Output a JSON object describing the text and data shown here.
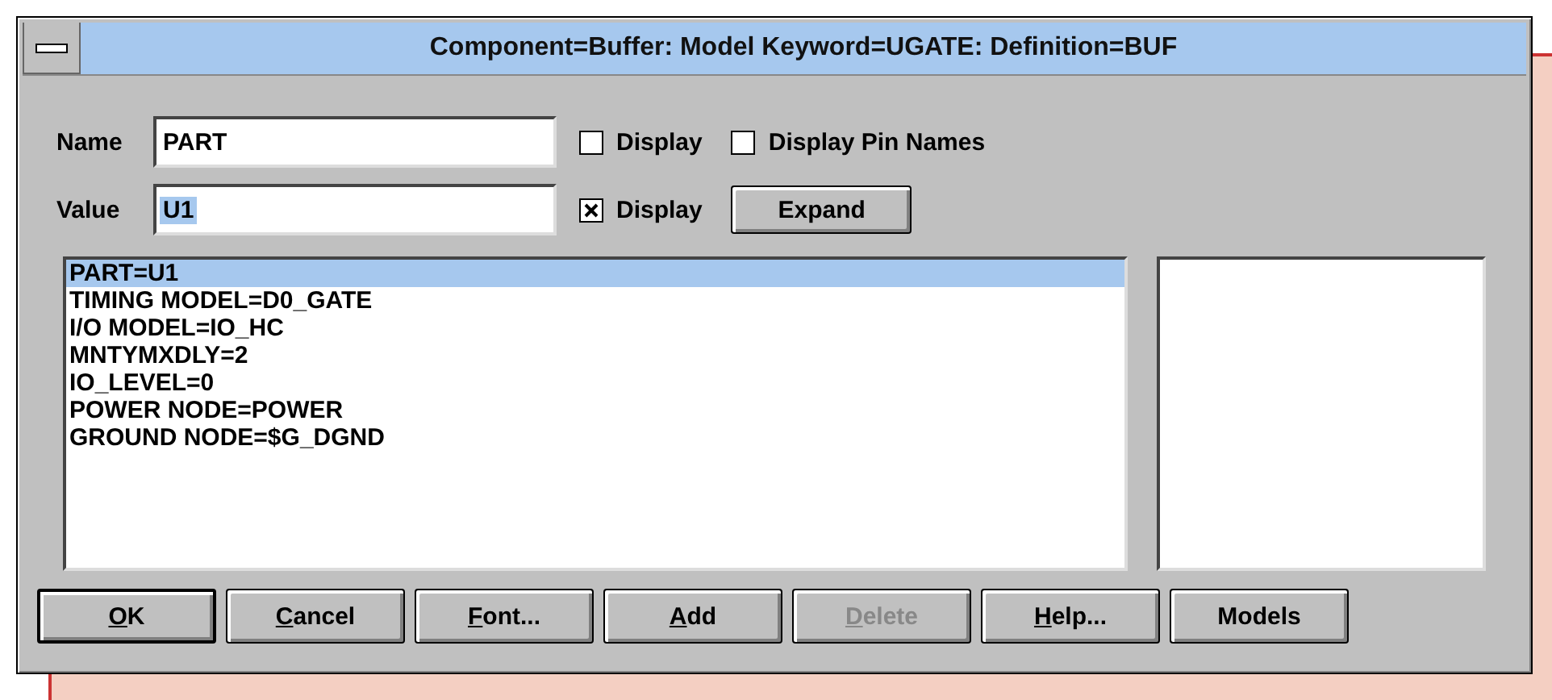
{
  "window": {
    "title": "Component=Buffer: Model Keyword=UGATE: Definition=BUF"
  },
  "fields": [
    {
      "label": "Name",
      "value": "PART",
      "value_selected": false,
      "display_label": "Display",
      "display_checked": false,
      "extra": {
        "kind": "checkbox",
        "label": "Display Pin Names",
        "checked": false
      }
    },
    {
      "label": "Value",
      "value": "U1",
      "value_selected": true,
      "display_label": "Display",
      "display_checked": true,
      "extra": {
        "kind": "button",
        "label": "Expand"
      }
    }
  ],
  "attributes": [
    {
      "text": "PART=U1",
      "selected": true
    },
    {
      "text": "TIMING MODEL=D0_GATE",
      "selected": false
    },
    {
      "text": "I/O MODEL=IO_HC",
      "selected": false
    },
    {
      "text": "MNTYMXDLY=2",
      "selected": false
    },
    {
      "text": "IO_LEVEL=0",
      "selected": false
    },
    {
      "text": "POWER NODE=POWER",
      "selected": false
    },
    {
      "text": "GROUND NODE=$G_DGND",
      "selected": false
    }
  ],
  "buttons": [
    {
      "accel": "O",
      "rest": "K",
      "default": true,
      "disabled": false
    },
    {
      "accel": "C",
      "rest": "ancel",
      "default": false,
      "disabled": false
    },
    {
      "accel": "F",
      "rest": "ont...",
      "default": false,
      "disabled": false
    },
    {
      "accel": "A",
      "rest": "dd",
      "default": false,
      "disabled": false
    },
    {
      "accel": "D",
      "rest": "elete",
      "default": false,
      "disabled": true
    },
    {
      "accel": "H",
      "rest": "elp...",
      "default": false,
      "disabled": false
    },
    {
      "rest": "Models",
      "default": false,
      "disabled": false
    }
  ]
}
